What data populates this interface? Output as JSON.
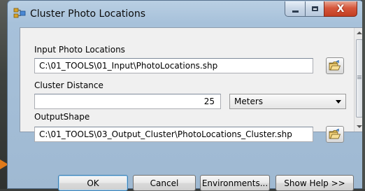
{
  "window": {
    "title": "Cluster Photo Locations",
    "close_glyph": "X"
  },
  "form": {
    "input_label": "Input Photo Locations",
    "input_value": "C:\\01_TOOLS\\01_Input\\PhotoLocations.shp",
    "distance_label": "Cluster Distance",
    "distance_value": "25",
    "unit_value": "Meters",
    "output_label": "OutputShape",
    "output_value": "C:\\01_TOOLS\\03_Output_Cluster\\PhotoLocations_Cluster.shp"
  },
  "buttons": {
    "ok": "OK",
    "cancel": "Cancel",
    "environments": "Environments...",
    "show_help": "Show Help >>"
  },
  "colors": {
    "accent": "#3c7fb1",
    "close_red": "#c23e22"
  },
  "icons": {
    "app": "toolbox-script-icon",
    "browse": "open-folder-icon"
  }
}
